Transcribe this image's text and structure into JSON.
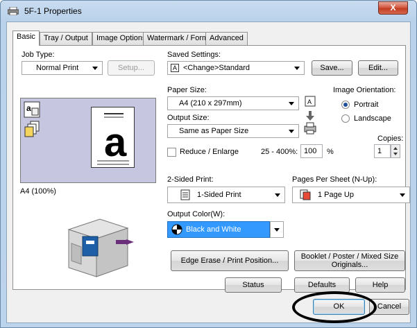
{
  "window": {
    "title": "5F-1 Properties",
    "close_label": "X"
  },
  "tabs": [
    {
      "label": "Basic"
    },
    {
      "label": "Tray / Output"
    },
    {
      "label": "Image Options"
    },
    {
      "label": "Watermark / Forms"
    },
    {
      "label": "Advanced"
    }
  ],
  "basic": {
    "job_type_label": "Job Type:",
    "job_type_value": "Normal Print",
    "setup_label": "Setup...",
    "preview_caption": "A4 (100%)",
    "saved_settings_label": "Saved Settings:",
    "saved_settings_value": "<Change>Standard",
    "save_label": "Save...",
    "edit_label": "Edit...",
    "paper_size_label": "Paper Size:",
    "paper_size_value": "A4 (210 x 297mm)",
    "output_size_label": "Output Size:",
    "output_size_value": "Same as Paper Size",
    "image_orientation_label": "Image Orientation:",
    "portrait_label": "Portrait",
    "landscape_label": "Landscape",
    "reduce_enlarge_label": "Reduce / Enlarge",
    "range_label": "25 - 400%:",
    "zoom_value": "100",
    "percent_label": "%",
    "copies_label": "Copies:",
    "copies_value": "1",
    "two_sided_label": "2-Sided Print:",
    "two_sided_value": "1-Sided Print",
    "pages_per_sheet_label": "Pages Per Sheet (N-Up):",
    "pages_per_sheet_value": "1 Page Up",
    "output_color_label": "Output Color(W):",
    "output_color_value": "Black and White",
    "edge_erase_label": "Edge Erase / Print Position...",
    "booklet_label": "Booklet / Poster / Mixed Size Originals...",
    "status_label": "Status",
    "defaults_label": "Defaults",
    "help_label": "Help"
  },
  "footer": {
    "ok_label": "OK",
    "cancel_label": "Cancel"
  },
  "colors": {
    "accent": "#3399ff",
    "preview_bg": "#c6c6e0"
  }
}
